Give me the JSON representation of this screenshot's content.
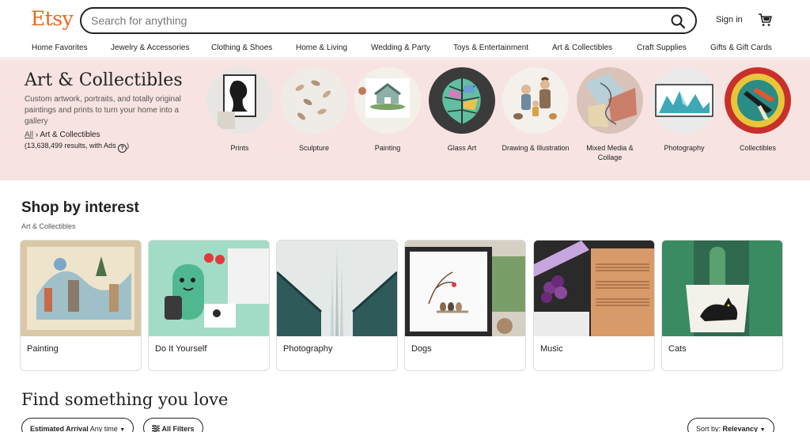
{
  "header": {
    "logo": "Etsy",
    "search_placeholder": "Search for anything",
    "sign_in": "Sign in"
  },
  "nav": [
    "Home Favorites",
    "Jewelry & Accessories",
    "Clothing & Shoes",
    "Home & Living",
    "Wedding & Party",
    "Toys & Entertainment",
    "Art & Collectibles",
    "Craft Supplies",
    "Gifts & Gift Cards"
  ],
  "hero": {
    "title": "Art & Collectibles",
    "description": "Custom artwork, portraits, and totally original paintings and prints to turn your home into a gallery",
    "breadcrumb_all": "All",
    "breadcrumb_sep": "›",
    "breadcrumb_current": "Art & Collectibles",
    "results": "(13,638,499 results, with Ads",
    "results_end": ")",
    "categories": [
      {
        "label": "Prints"
      },
      {
        "label": "Sculpture"
      },
      {
        "label": "Painting"
      },
      {
        "label": "Glass Art"
      },
      {
        "label": "Drawing & Illustration"
      },
      {
        "label": "Mixed Media & Collage"
      },
      {
        "label": "Photography"
      },
      {
        "label": "Collectibles"
      }
    ]
  },
  "shop_by_interest": {
    "title": "Shop by interest",
    "subtitle": "Art & Collectibles",
    "cards": [
      {
        "label": "Painting"
      },
      {
        "label": "Do It Yourself"
      },
      {
        "label": "Photography"
      },
      {
        "label": "Dogs"
      },
      {
        "label": "Music"
      },
      {
        "label": "Cats"
      }
    ]
  },
  "find": {
    "title": "Find something you love",
    "estimated_label": "Estimated Arrival",
    "estimated_value": "Any time",
    "all_filters": "All Filters",
    "sort_label": "Sort by:",
    "sort_value": "Relevancy"
  },
  "colors": {
    "brand": "#f1641e",
    "hero_bg": "#f7e4e2"
  }
}
